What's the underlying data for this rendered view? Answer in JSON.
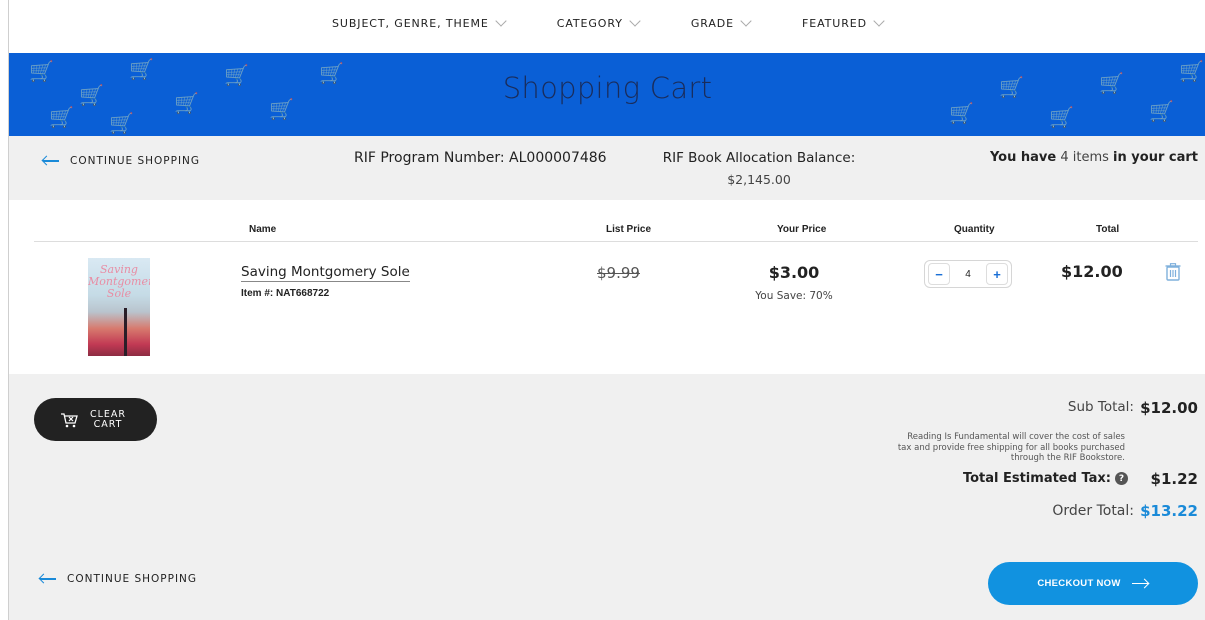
{
  "nav": {
    "items": [
      {
        "label": "SUBJECT, GENRE, THEME"
      },
      {
        "label": "CATEGORY"
      },
      {
        "label": "GRADE"
      },
      {
        "label": "FEATURED"
      }
    ]
  },
  "banner": {
    "title": "Shopping Cart"
  },
  "info": {
    "continue_label": "CONTINUE SHOPPING",
    "program_label": "RIF Program Number: AL000007486",
    "allocation_label": "RIF Book Allocation Balance:",
    "allocation_value": "$2,145.00",
    "items_prefix": "You have",
    "items_count": "4 items",
    "items_suffix": "in your cart"
  },
  "table": {
    "headers": {
      "name": "Name",
      "list_price": "List Price",
      "your_price": "Your Price",
      "quantity": "Quantity",
      "total": "Total"
    },
    "rows": [
      {
        "cover_text": "Saving Montgomery Sole",
        "name": "Saving Montgomery Sole",
        "item_number": "Item #: NAT668722",
        "list_price": "$9.99",
        "your_price": "$3.00",
        "savings": "You Save: 70%",
        "quantity": "4",
        "total": "$12.00"
      }
    ]
  },
  "summary": {
    "clear_label": "CLEAR CART",
    "subtotal_label": "Sub Total:",
    "subtotal_value": "$12.00",
    "note": "Reading Is Fundamental will cover the cost of sales tax and provide free shipping for all books purchased through the RIF Bookstore.",
    "tax_label": "Total Estimated Tax:",
    "tax_value": "$1.22",
    "order_label": "Order Total:",
    "order_value": "$13.22",
    "continue_label": "CONTINUE SHOPPING",
    "checkout_label": "CHECKOUT NOW"
  },
  "colors": {
    "banner": "#0a5fd6",
    "accent": "#1192e0",
    "order_total": "#1a8ad8",
    "clear_button": "#222222"
  },
  "icons": [
    "chevron-down-icon",
    "arrow-left-icon",
    "arrow-right-icon",
    "trash-icon",
    "cart-clear-icon",
    "help-icon",
    "minus-icon",
    "plus-icon"
  ]
}
